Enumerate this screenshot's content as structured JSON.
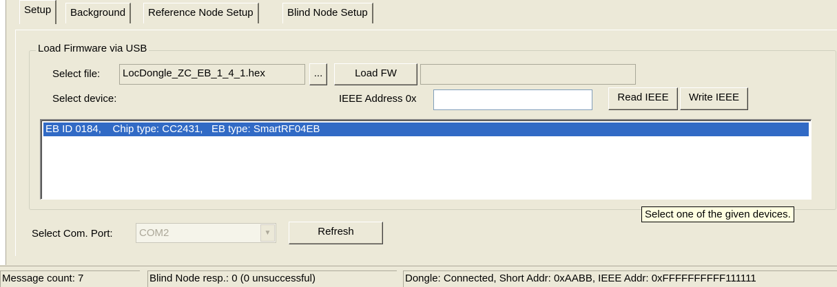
{
  "tabs": [
    {
      "label": "Setup",
      "active": true
    },
    {
      "label": "Background",
      "active": false
    },
    {
      "label": "Reference Node Setup",
      "active": false
    },
    {
      "label": "Blind Node Setup",
      "active": false
    }
  ],
  "firmware_group": {
    "title": "Load Firmware via USB",
    "select_file_label": "Select file:",
    "file_value": "LocDongle_ZC_EB_1_4_1.hex",
    "browse_label": "...",
    "load_fw_label": "Load FW",
    "progress_text": "",
    "select_device_label": "Select device:",
    "ieee_address_label": "IEEE Address 0x",
    "ieee_address_value": "",
    "read_ieee_label": "Read IEEE",
    "write_ieee_label": "Write IEEE",
    "devices": [
      {
        "text": "EB ID 0184,    Chip type: CC2431,   EB type: SmartRF04EB",
        "selected": true
      }
    ]
  },
  "tooltip_text": "Select one of the given devices.",
  "com_port": {
    "label": "Select Com. Port:",
    "value": "COM2",
    "refresh_label": "Refresh"
  },
  "status_bar": {
    "message_count": "Message count: 7",
    "blind_node_resp": "Blind Node resp.: 0 (0 unsuccessful)",
    "dongle": "Dongle: Connected, Short Addr: 0xAABB, IEEE Addr: 0xFFFFFFFFFF111111"
  },
  "colors": {
    "window_bg": "#ece9d8",
    "selection": "#316ac5",
    "tooltip_bg": "#ffffe1"
  }
}
